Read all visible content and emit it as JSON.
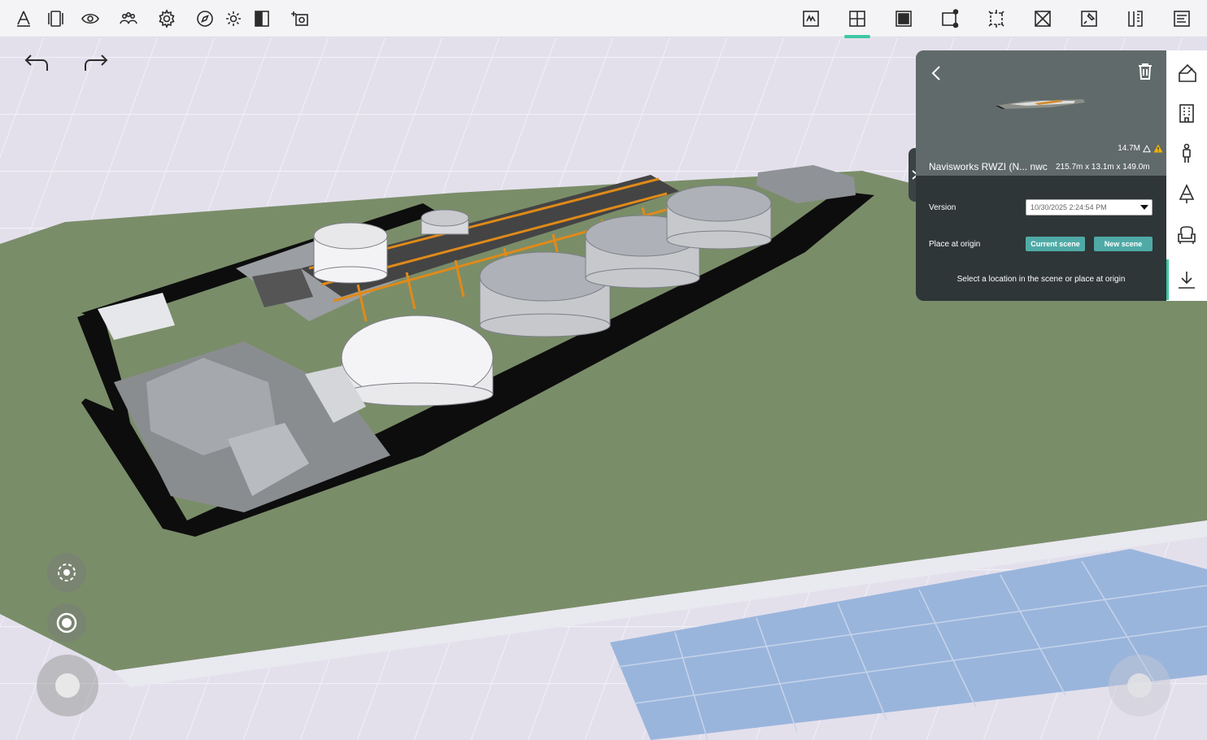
{
  "toolbar": {
    "left_icons": [
      "measure-icon",
      "views-icon",
      "visibility-icon",
      "collaborate-icon",
      "settings-icon",
      "navigation-icon",
      "lighting-icon",
      "section-icon",
      "camera-icon"
    ],
    "right_icons": [
      "sketch-mode-icon",
      "add-object-icon",
      "material-icon",
      "transform-icon",
      "scale-icon",
      "section-box-icon",
      "pin-icon",
      "measure-ruler-icon",
      "properties-icon"
    ],
    "active_right_index": 1,
    "accent_color": "#3fc7a4"
  },
  "history": {
    "undo_icon": "undo-icon",
    "redo_icon": "redo-icon"
  },
  "controls": {
    "orbit_icon": "orbit-icon",
    "focus_icon": "target-icon"
  },
  "model_panel": {
    "file_size": "14.7M",
    "name": "Navisworks RWZI (N... nwc",
    "dimensions": "215.7m x 13.1m x 149.0m",
    "version_label": "Version",
    "version_value": "10/30/2025 2:24:54 PM",
    "place_label": "Place at origin",
    "current_scene_label": "Current scene",
    "new_scene_label": "New scene",
    "hint": "Select a location in the scene or place at origin",
    "accent_color": "#4faaa6",
    "warning_color": "#f0b400"
  },
  "rail": {
    "items": [
      "shapes-icon",
      "building-icon",
      "person-icon",
      "tree-icon",
      "furniture-icon",
      "import-icon"
    ],
    "active_index": 5
  }
}
